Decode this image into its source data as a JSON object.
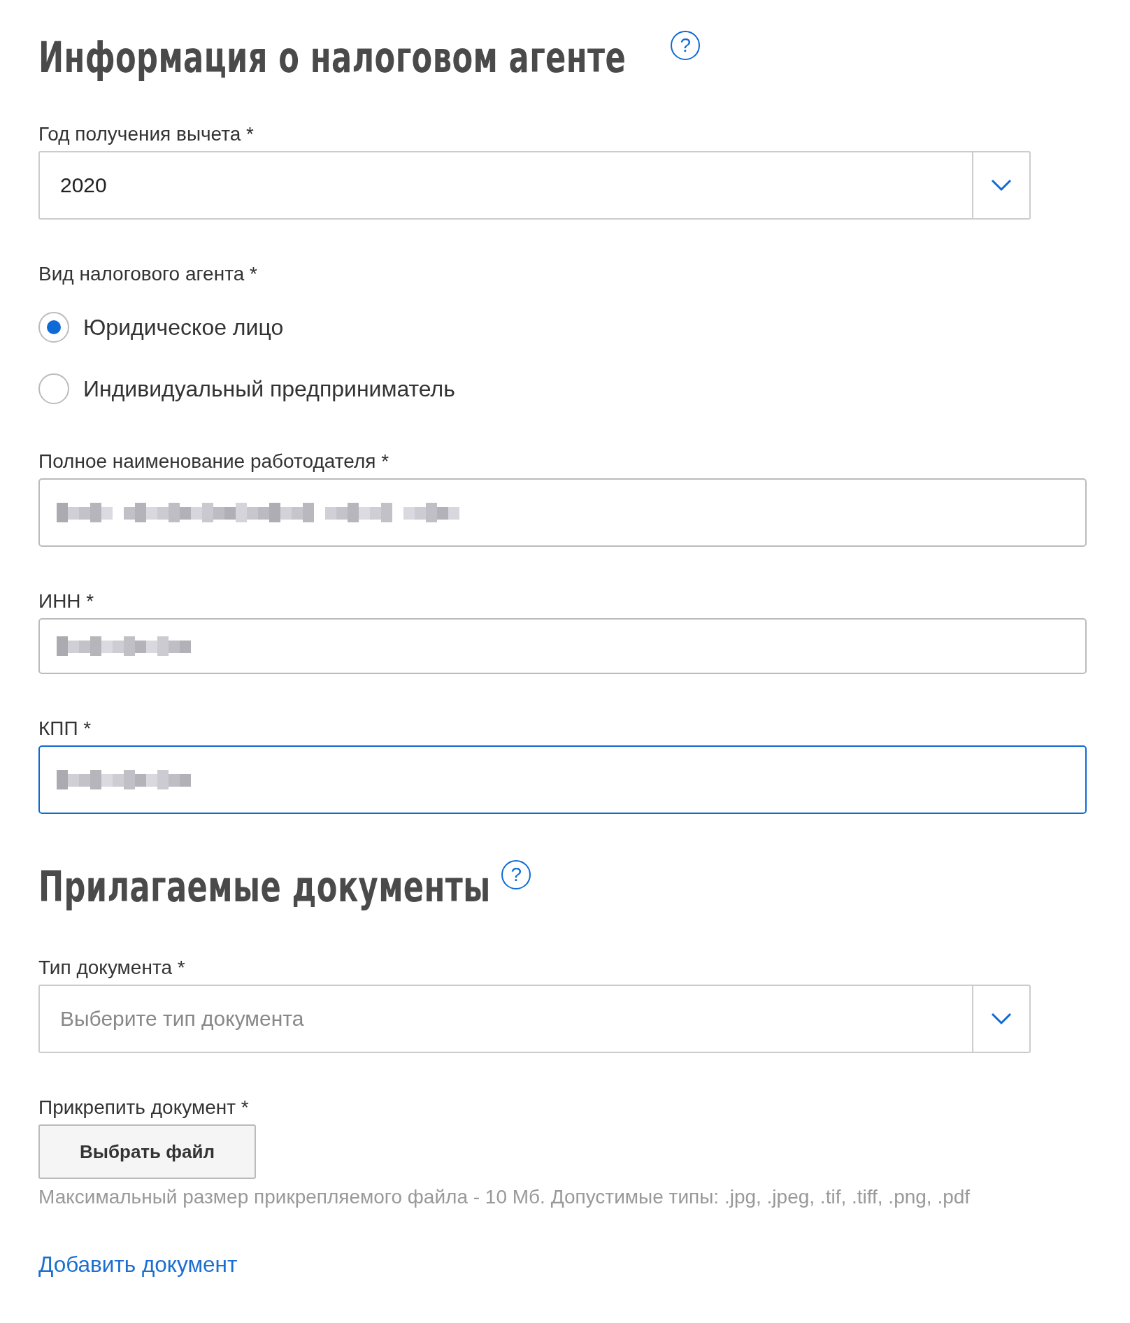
{
  "sections": [
    {
      "title": "Информация о налоговом агенте",
      "help": "?",
      "fields": [
        {
          "kind": "select",
          "label": "Год получения вычета *",
          "value": "2020"
        },
        {
          "kind": "radio",
          "label": "Вид налогового агента *",
          "options": [
            {
              "label": "Юридическое лицо",
              "selected": true
            },
            {
              "label": "Индивидуальный предприниматель",
              "selected": false
            }
          ]
        },
        {
          "kind": "redacted",
          "label": "Полное наименование работодателя *",
          "tall": true,
          "focused": false
        },
        {
          "kind": "redacted",
          "label": "ИНН *",
          "tall": false,
          "focused": false
        },
        {
          "kind": "redacted",
          "label": "КПП *",
          "tall": true,
          "focused": true
        }
      ]
    },
    {
      "title": "Прилагаемые документы",
      "help": "?",
      "fields": [
        {
          "kind": "select",
          "label": "Тип документа *",
          "placeholder": "Выберите тип документа"
        },
        {
          "kind": "file",
          "label": "Прикрепить документ *",
          "button": "Выбрать файл",
          "hint": "Максимальный размер прикрепляемого файла - 10 Мб. Допустимые типы: .jpg, .jpeg, .tif, .tiff, .png, .pdf"
        }
      ]
    }
  ],
  "add_link": "Добавить документ"
}
